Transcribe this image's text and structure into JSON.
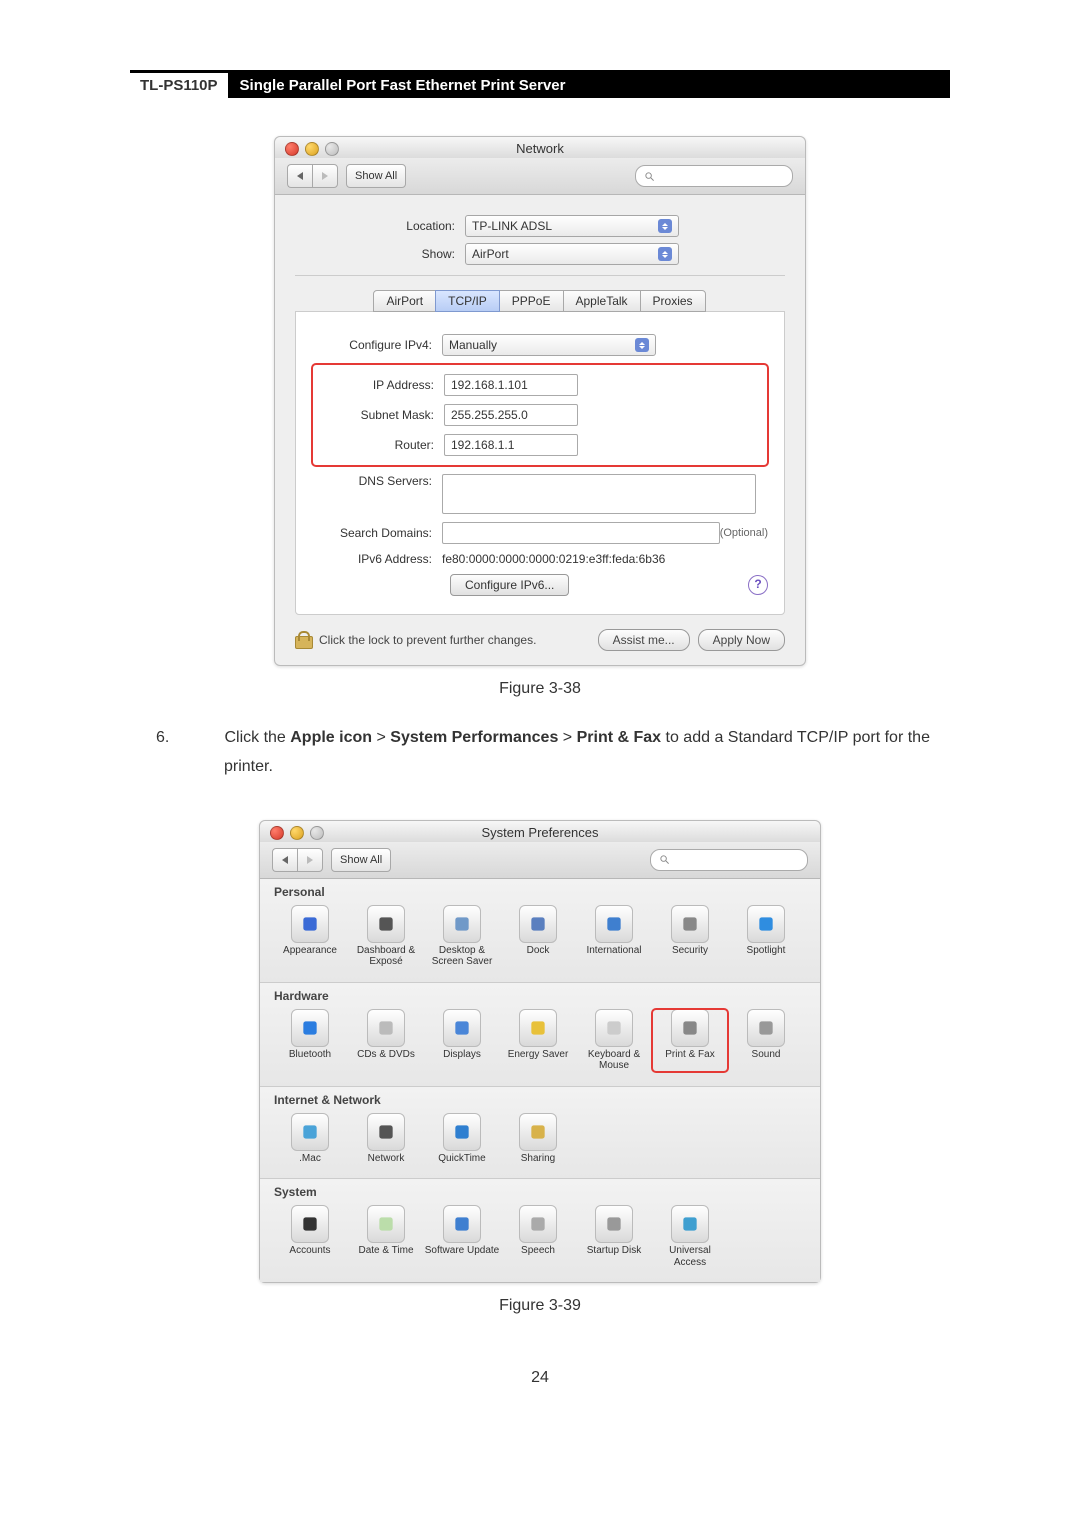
{
  "header": {
    "model": "TL-PS110P",
    "title": "Single Parallel Port Fast Ethernet Print Server"
  },
  "page_number": "24",
  "step": {
    "number": "6.",
    "prefix": "Click the ",
    "bold1": "Apple icon",
    "sep1": " > ",
    "bold2": "System Performances",
    "sep2": " > ",
    "bold3": "Print & Fax",
    "suffix": " to add a Standard TCP/IP port for the printer."
  },
  "fig1_caption": "Figure 3-38",
  "fig2_caption": "Figure 3-39",
  "network": {
    "window_title": "Network",
    "show_all": "Show All",
    "location_label": "Location:",
    "location_value": "TP-LINK ADSL",
    "show_label": "Show:",
    "show_value": "AirPort",
    "tabs": [
      "AirPort",
      "TCP/IP",
      "PPPoE",
      "AppleTalk",
      "Proxies"
    ],
    "active_tab": "TCP/IP",
    "cfg4_label": "Configure IPv4:",
    "cfg4_value": "Manually",
    "ip_label": "IP Address:",
    "ip_value": "192.168.1.101",
    "mask_label": "Subnet Mask:",
    "mask_value": "255.255.255.0",
    "router_label": "Router:",
    "router_value": "192.168.1.1",
    "dns_label": "DNS Servers:",
    "search_label": "Search Domains:",
    "optional": "(Optional)",
    "ipv6_label": "IPv6 Address:",
    "ipv6_value": "fe80:0000:0000:0000:0219:e3ff:feda:6b36",
    "cfg6_btn": "Configure IPv6...",
    "lock_text": "Click the lock to prevent further changes.",
    "assist_btn": "Assist me...",
    "apply_btn": "Apply Now"
  },
  "sysprefs": {
    "window_title": "System Preferences",
    "show_all": "Show All",
    "sections": {
      "personal": {
        "title": "Personal",
        "items": [
          "Appearance",
          "Dashboard & Exposé",
          "Desktop & Screen Saver",
          "Dock",
          "International",
          "Security",
          "Spotlight"
        ]
      },
      "hardware": {
        "title": "Hardware",
        "items": [
          "Bluetooth",
          "CDs & DVDs",
          "Displays",
          "Energy Saver",
          "Keyboard & Mouse",
          "Print & Fax",
          "Sound"
        ]
      },
      "internet": {
        "title": "Internet & Network",
        "items": [
          ".Mac",
          "Network",
          "QuickTime",
          "Sharing"
        ]
      },
      "system": {
        "title": "System",
        "items": [
          "Accounts",
          "Date & Time",
          "Software Update",
          "Speech",
          "Startup Disk",
          "Universal Access"
        ]
      }
    },
    "highlight": "Print & Fax"
  }
}
